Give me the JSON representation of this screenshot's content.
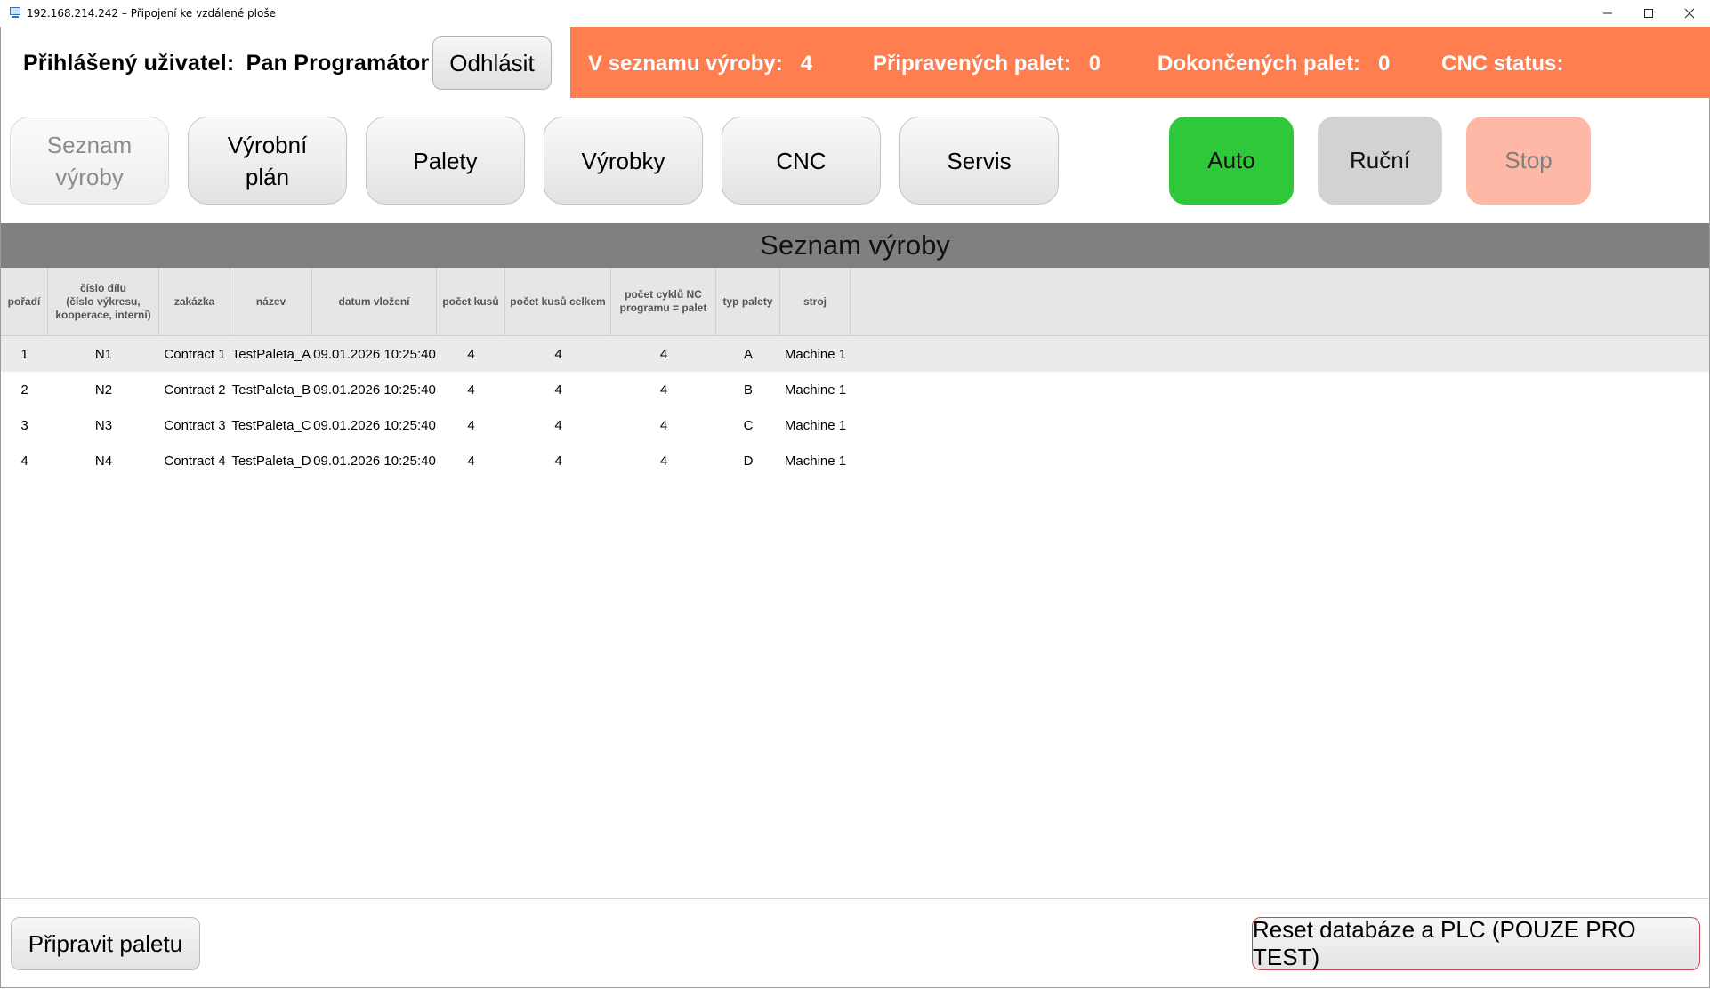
{
  "window": {
    "title": "192.168.214.242 – Připojení ke vzdálené ploše",
    "icon": "remote-desktop-icon"
  },
  "header": {
    "user_label": "Přihlášený uživatel:",
    "user_name": "Pan Programátor",
    "logout_label": "Odhlásit"
  },
  "status": {
    "background": "#ff7e50",
    "in_list_label": "V seznamu výroby:",
    "in_list_value": "4",
    "prepared_label": "Připravených palet:",
    "prepared_value": "0",
    "finished_label": "Dokončených palet:",
    "finished_value": "0",
    "cnc_label": "CNC status:",
    "cnc_value": ""
  },
  "nav": {
    "items": [
      {
        "label": "Seznam\nvýroby",
        "active": true
      },
      {
        "label": "Výrobní\nplán"
      },
      {
        "label": "Palety"
      },
      {
        "label": "Výrobky"
      },
      {
        "label": "CNC"
      },
      {
        "label": "Servis"
      }
    ]
  },
  "modes": {
    "auto": {
      "label": "Auto",
      "color": "#2ec83a"
    },
    "manual": {
      "label": "Ruční",
      "color": "#d2d2d2"
    },
    "stop": {
      "label": "Stop",
      "color": "#ffb8a6"
    }
  },
  "section_title": "Seznam výroby",
  "table": {
    "columns": [
      "pořadí",
      "číslo dílu\n(číslo výkresu,\nkooperace, interní)",
      "zakázka",
      "název",
      "datum vložení",
      "počet kusů",
      "počet kusů celkem",
      "počet cyklů NC\nprogramu = palet",
      "typ palety",
      "stroj"
    ],
    "rows": [
      [
        "1",
        "N1",
        "Contract 1",
        "TestPaleta_A",
        "09.01.2026 10:25:40",
        "4",
        "4",
        "4",
        "A",
        "Machine 1"
      ],
      [
        "2",
        "N2",
        "Contract 2",
        "TestPaleta_B",
        "09.01.2026 10:25:40",
        "4",
        "4",
        "4",
        "B",
        "Machine 1"
      ],
      [
        "3",
        "N3",
        "Contract 3",
        "TestPaleta_C",
        "09.01.2026 10:25:40",
        "4",
        "4",
        "4",
        "C",
        "Machine 1"
      ],
      [
        "4",
        "N4",
        "Contract 4",
        "TestPaleta_D",
        "09.01.2026 10:25:40",
        "4",
        "4",
        "4",
        "D",
        "Machine 1"
      ]
    ],
    "selected_row": 0
  },
  "footer": {
    "prepare_label": "Připravit paletu",
    "reset_label": "Reset databáze a PLC (POUZE PRO TEST)"
  }
}
